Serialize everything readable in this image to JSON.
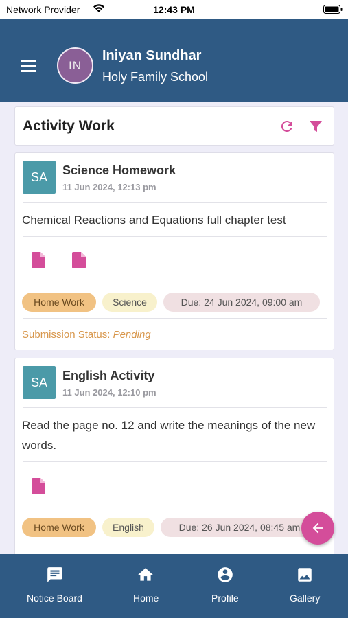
{
  "status_bar": {
    "provider": "Network Provider",
    "time": "12:43 PM"
  },
  "header": {
    "avatar_initials": "IN",
    "user_name": "Iniyan Sundhar",
    "school_name": "Holy Family School"
  },
  "page": {
    "title": "Activity Work"
  },
  "activities": [
    {
      "avatar": "SA",
      "title": "Science Homework",
      "date": "11 Jun 2024, 12:13 pm",
      "description": "Chemical Reactions and Equations full chapter test",
      "attachments": [
        "file-icon",
        "file-icon"
      ],
      "type": "Home Work",
      "subject": "Science",
      "due": "Due: 24 Jun 2024, 09:00 am",
      "submission_label": "Submission Status:",
      "submission_status": "Pending"
    },
    {
      "avatar": "SA",
      "title": "English Activity",
      "date": "11 Jun 2024, 12:10 pm",
      "description": "Read the page no. 12 and write the meanings of the new words.",
      "attachments": [
        "file-icon"
      ],
      "type": "Home Work",
      "subject": "English",
      "due": "Due: 26 Jun 2024, 08:45 am"
    }
  ],
  "bottom_nav": [
    {
      "label": "Notice Board",
      "icon": "notice-board-icon"
    },
    {
      "label": "Home",
      "icon": "home-icon"
    },
    {
      "label": "Profile",
      "icon": "profile-icon"
    },
    {
      "label": "Gallery",
      "icon": "gallery-icon"
    }
  ],
  "colors": {
    "header_bg": "#2f5a84",
    "accent": "#d44d9a",
    "chip_type": "#f1c283",
    "chip_subject": "#f8f1cc",
    "chip_due": "#f0e0e2",
    "submission_text": "#d8974c",
    "card_avatar": "#4b9aa8",
    "user_avatar": "#8a5f96"
  }
}
